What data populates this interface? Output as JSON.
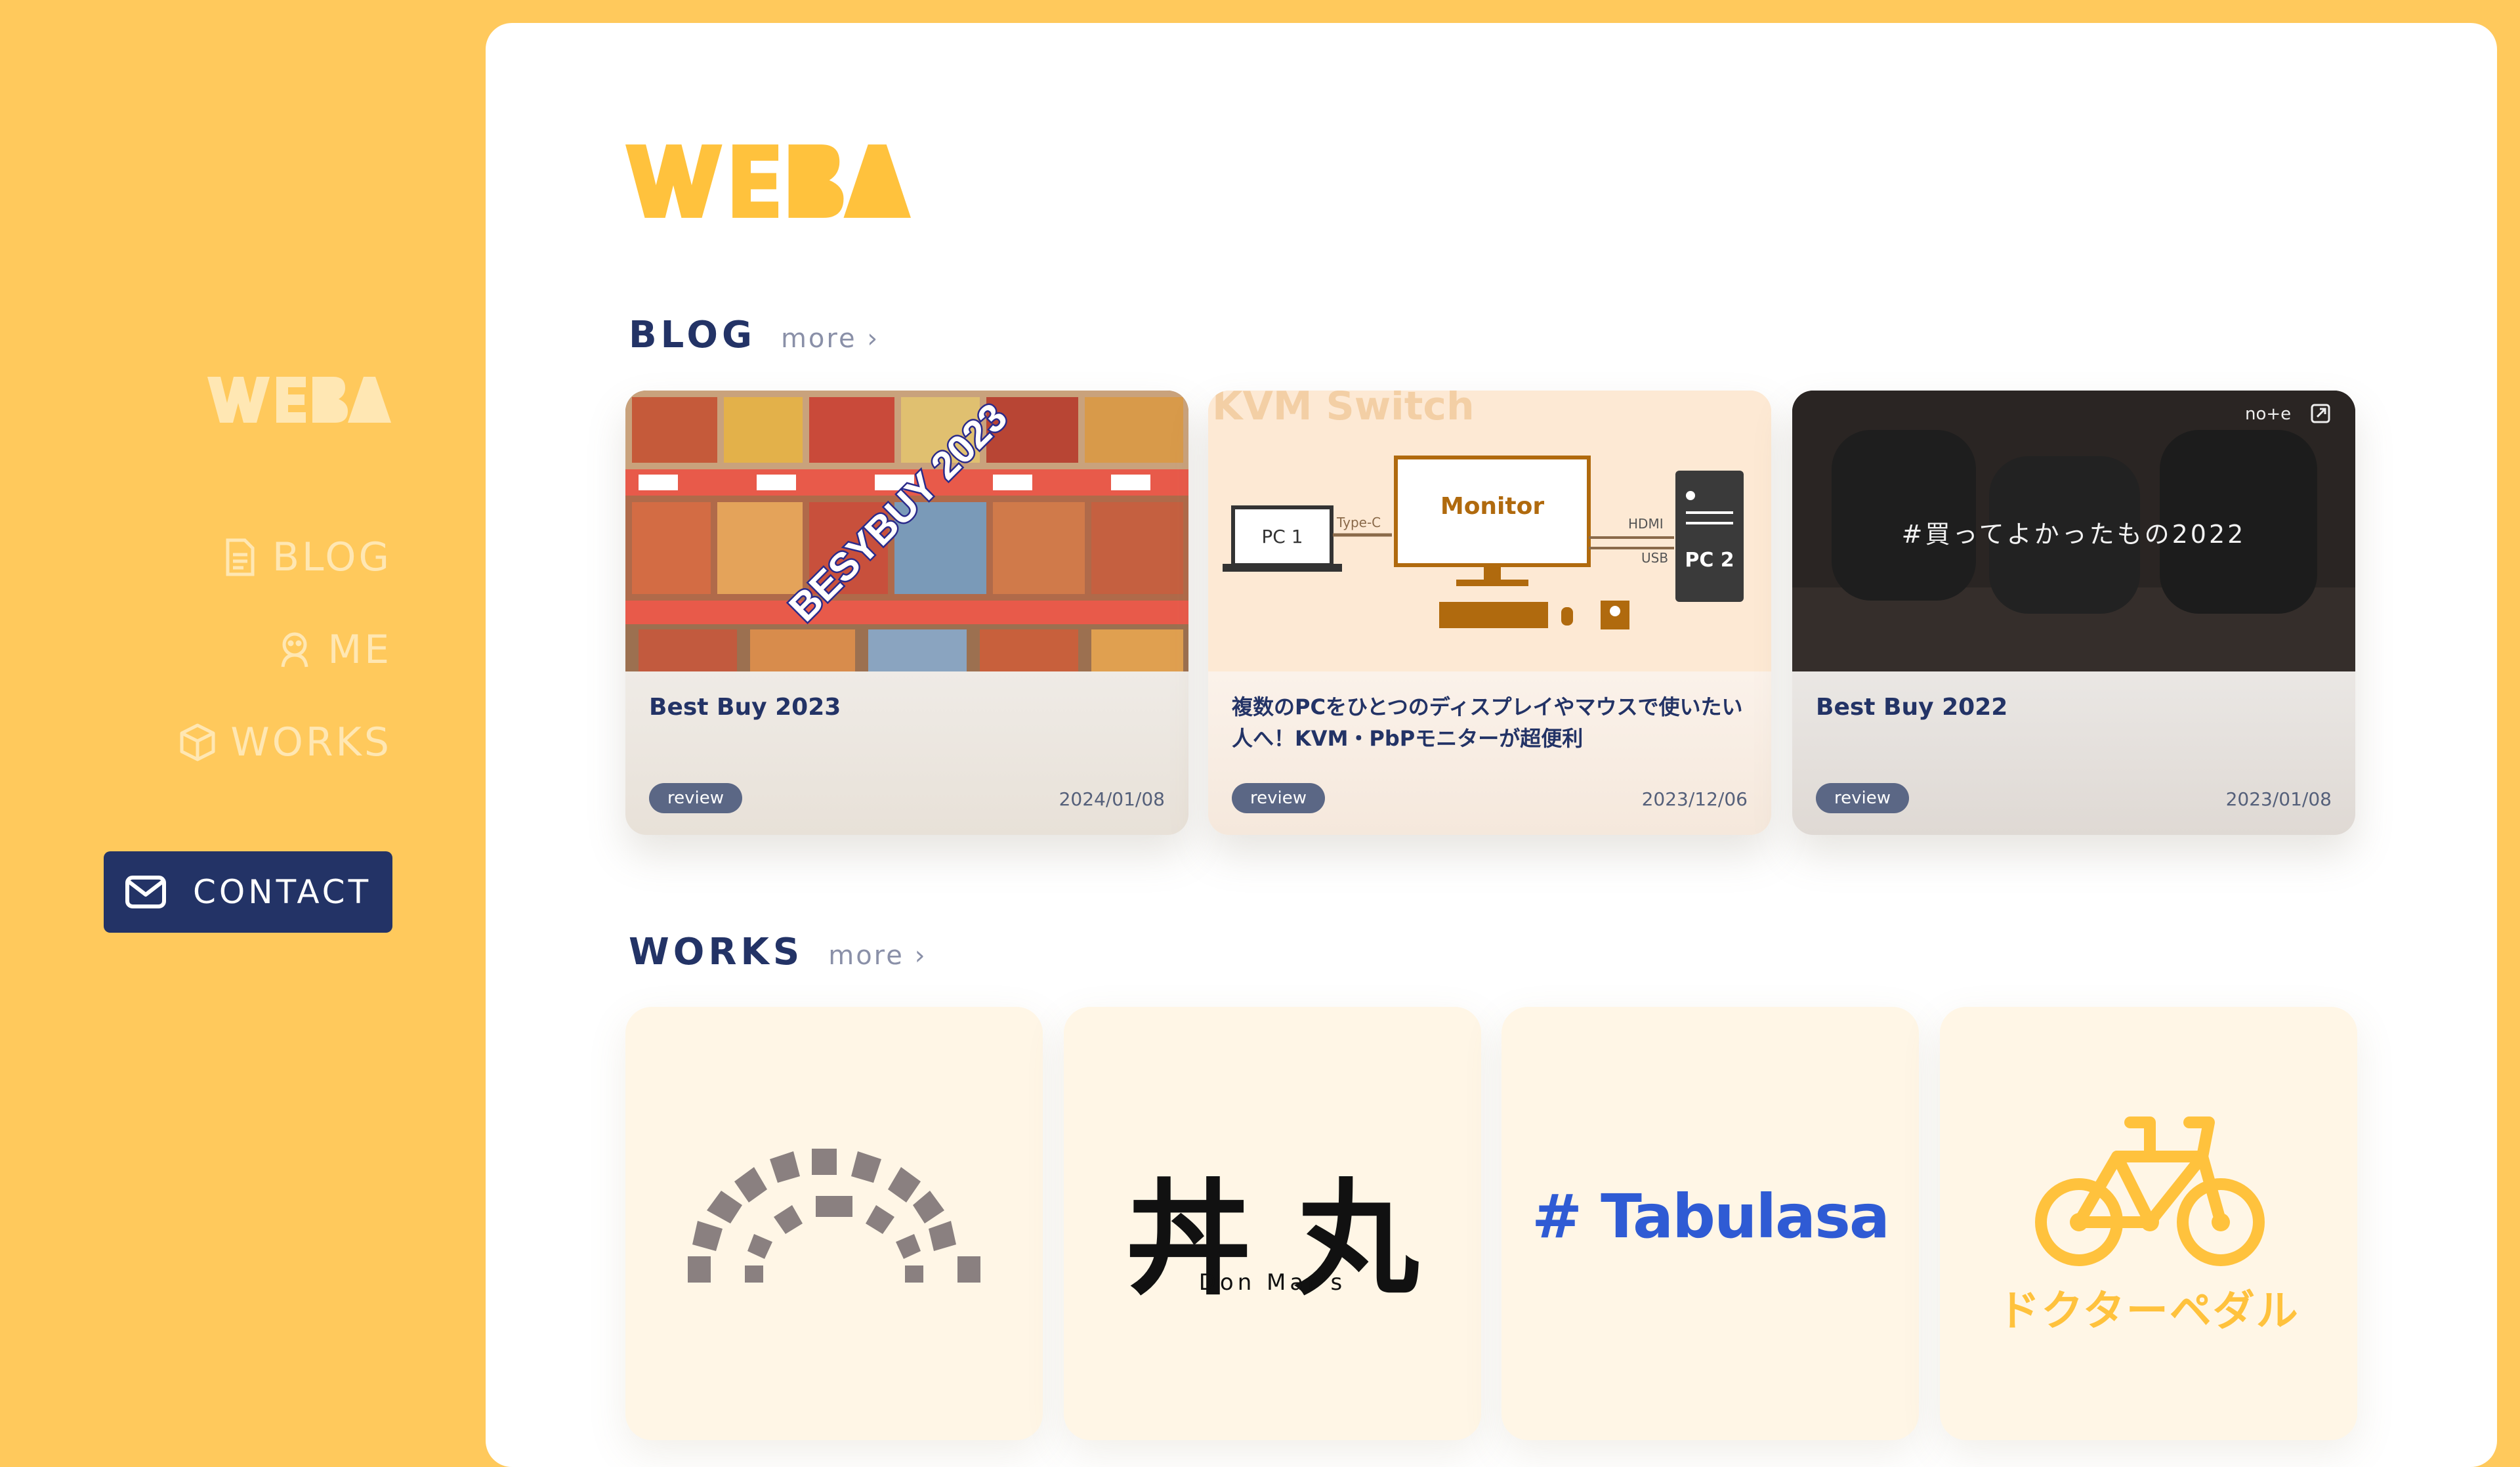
{
  "sidebar": {
    "logo_text": "WEBA",
    "nav": [
      {
        "label": "BLOG",
        "icon": "document-icon"
      },
      {
        "label": "ME",
        "icon": "person-icon"
      },
      {
        "label": "WORKS",
        "icon": "box-icon"
      }
    ],
    "contact_label": "CONTACT"
  },
  "main": {
    "logo_text": "WEBA",
    "blog": {
      "title": "BLOG",
      "more": "more ›",
      "cards": [
        {
          "thumb_text": "BESYBUY 2023",
          "title": "Best Buy 2023",
          "tag": "review",
          "date": "2024/01/08"
        },
        {
          "thumb_title": "KVM Switch",
          "thumb_pc1": "PC 1",
          "thumb_typec": "Type-C",
          "thumb_monitor": "Monitor",
          "thumb_hdmi": "HDMI",
          "thumb_usb": "USB",
          "thumb_pc2": "PC 2",
          "title": "複数のPCをひとつのディスプレイやマウスで使いたい人へ！KVM・PbPモニターが超便利",
          "tag": "review",
          "date": "2023/12/06"
        },
        {
          "thumb_text": "#買ってよかったもの2022",
          "thumb_badge": "no+e",
          "title": "Best Buy 2022",
          "tag": "review",
          "date": "2023/01/08"
        }
      ]
    },
    "works": {
      "title": "WORKS",
      "more": "more ›",
      "items": [
        {
          "name": "arc-logo"
        },
        {
          "name": "donmars",
          "kanji": "丼 丸",
          "sub": "Don Mar's"
        },
        {
          "name": "tabulasa",
          "text": "# Tabulasa"
        },
        {
          "name": "doctor-pedal",
          "text": "ドクターペダル"
        }
      ]
    }
  },
  "colors": {
    "background": "#ffc95c",
    "navy": "#233366",
    "accent_yellow": "#ffc23d",
    "blue": "#2f5bd4"
  }
}
